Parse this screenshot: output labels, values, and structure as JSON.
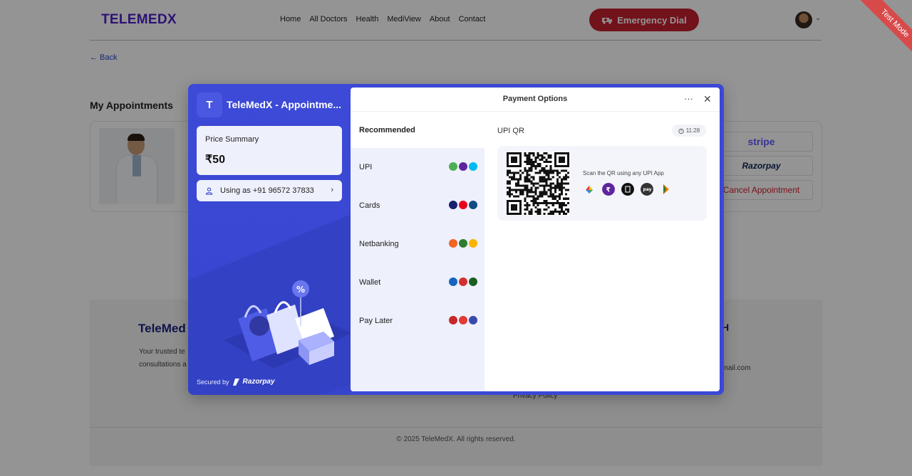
{
  "header": {
    "logo": "TELEMEDX",
    "nav": [
      "Home",
      "All Doctors",
      "Health",
      "MediView",
      "About",
      "Contact"
    ],
    "emergency_label": "Emergency Dial"
  },
  "back_label": "← Back",
  "section_title": "My Appointments",
  "appointment": {
    "stripe_label": "stripe",
    "razorpay_label": "Razorpay",
    "cancel_label": "Cancel Appointment"
  },
  "footer": {
    "brand": "TeleMed",
    "desc": "Your trusted te consultations a",
    "heading_partial": "H",
    "email_partial": "gmail.com",
    "privacy": "Privacy Policy",
    "copyright": "© 2025 TeleMedX. All rights reserved."
  },
  "test_mode": "Test Mode",
  "modal": {
    "merchant_initial": "T",
    "merchant_name": "TeleMedX - Appointme...",
    "price_label": "Price Summary",
    "price_value": "₹50",
    "user_label": "Using as +91 96572 37833",
    "secured_by": "Secured by",
    "secured_brand": "Razorpay",
    "title": "Payment Options",
    "recommended": "Recommended",
    "methods": [
      {
        "label": "UPI",
        "icons": [
          "#4caf50",
          "#5f259f",
          "#00baf2"
        ]
      },
      {
        "label": "Cards",
        "icons": [
          "#1a1f71",
          "#eb001b",
          "#0f4c81"
        ]
      },
      {
        "label": "Netbanking",
        "icons": [
          "#f26522",
          "#2e7d32",
          "#f7b500"
        ]
      },
      {
        "label": "Wallet",
        "icons": [
          "#1565c0",
          "#d32f2f",
          "#1b5e20"
        ]
      },
      {
        "label": "Pay Later",
        "icons": [
          "#c62828",
          "#e53935",
          "#3949ab"
        ]
      }
    ],
    "qr_title": "UPI QR",
    "timer": "11:28",
    "scan_text": "Scan the QR using any UPI App",
    "upi_apps": [
      {
        "name": "google-pay",
        "color": "#ffffff"
      },
      {
        "name": "phonepe",
        "color": "#5f259f"
      },
      {
        "name": "bhim-upi",
        "color": "#111111"
      },
      {
        "name": "amazon-pay",
        "color": "#333333"
      },
      {
        "name": "bhim",
        "color": "#ffffff"
      }
    ]
  }
}
